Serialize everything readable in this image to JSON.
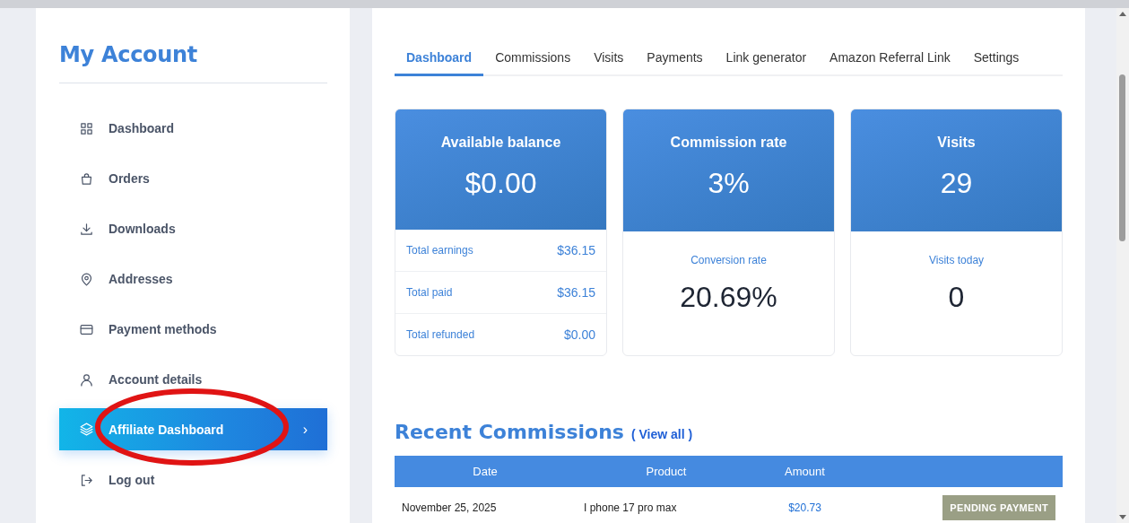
{
  "sidebar": {
    "title": "My Account",
    "items": [
      {
        "label": "Dashboard",
        "kind": "grid",
        "selected": false
      },
      {
        "label": "Orders",
        "kind": "bag",
        "selected": false
      },
      {
        "label": "Downloads",
        "kind": "download",
        "selected": false
      },
      {
        "label": "Addresses",
        "kind": "pin",
        "selected": false
      },
      {
        "label": "Payment methods",
        "kind": "card",
        "selected": false
      },
      {
        "label": "Account details",
        "kind": "user",
        "selected": false
      },
      {
        "label": "Affiliate Dashboard",
        "kind": "layers",
        "selected": true,
        "chevron": "›"
      },
      {
        "label": "Log out",
        "kind": "logout",
        "selected": false
      }
    ]
  },
  "tabs": [
    {
      "label": "Dashboard",
      "selected": true
    },
    {
      "label": "Commissions",
      "selected": false
    },
    {
      "label": "Visits",
      "selected": false
    },
    {
      "label": "Payments",
      "selected": false
    },
    {
      "label": "Link generator",
      "selected": false
    },
    {
      "label": "Amazon Referral Link",
      "selected": false
    },
    {
      "label": "Settings",
      "selected": false
    }
  ],
  "cards": [
    {
      "kind": "breakdown",
      "title": "Available balance",
      "value": "$0.00",
      "rows": [
        {
          "label": "Total earnings",
          "value": "$36.15"
        },
        {
          "label": "Total paid",
          "value": "$36.15"
        },
        {
          "label": "Total refunded",
          "value": "$0.00"
        }
      ]
    },
    {
      "kind": "single",
      "title": "Commission rate",
      "value": "3%",
      "sub_label": "Conversion rate",
      "sub_value": "20.69%"
    },
    {
      "kind": "single",
      "title": "Visits",
      "value": "29",
      "sub_label": "Visits today",
      "sub_value": "0"
    }
  ],
  "recent": {
    "title": "Recent Commissions",
    "link": "( View all )",
    "columns": [
      "Date",
      "Product",
      "Amount"
    ],
    "rows": [
      {
        "date": "November 25, 2025",
        "product": "I phone 17 pro max",
        "amount": "$20.73",
        "status": "PENDING PAYMENT"
      }
    ]
  }
}
